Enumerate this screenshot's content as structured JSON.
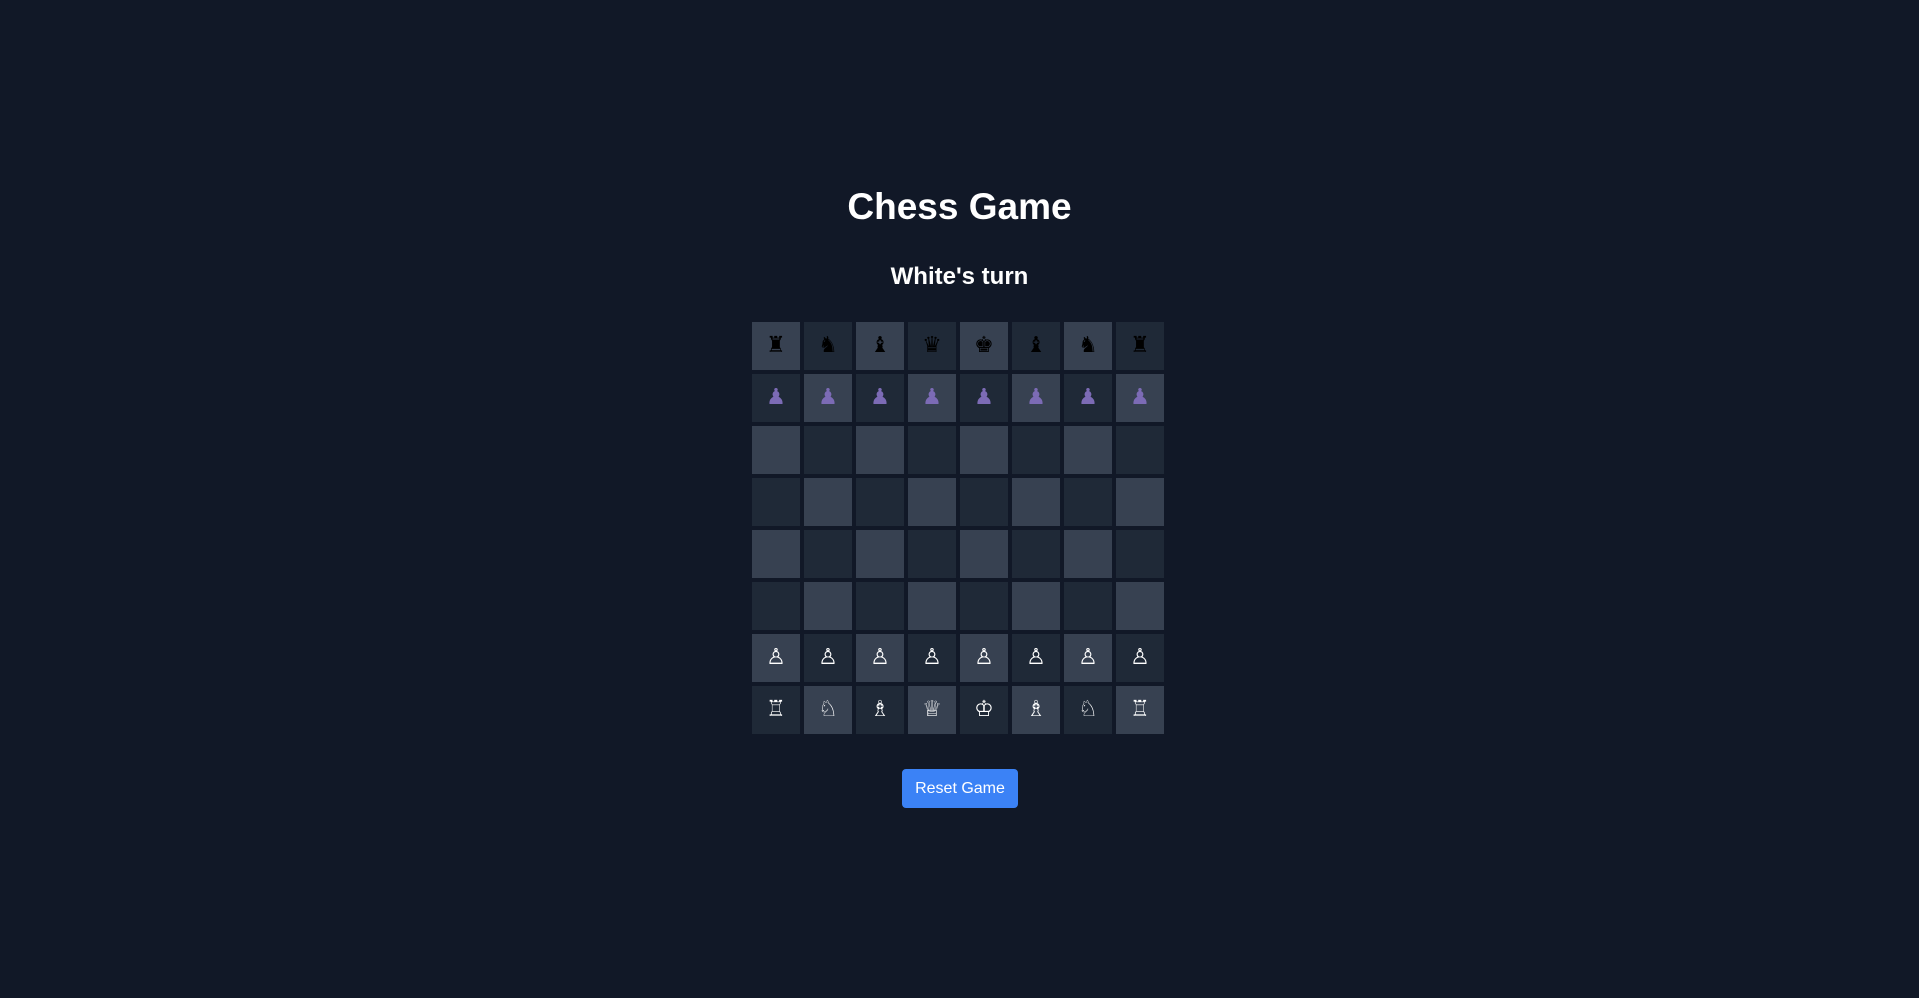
{
  "header": {
    "title": "Chess Game",
    "status": "White's turn"
  },
  "board": {
    "light_color": "#374151",
    "dark_color": "#1f2937",
    "rows": [
      [
        {
          "glyph": "♜",
          "piece": "black-rook",
          "color": "black"
        },
        {
          "glyph": "♞",
          "piece": "black-knight",
          "color": "black"
        },
        {
          "glyph": "♝",
          "piece": "black-bishop",
          "color": "black"
        },
        {
          "glyph": "♛",
          "piece": "black-queen",
          "color": "black"
        },
        {
          "glyph": "♚",
          "piece": "black-king",
          "color": "black"
        },
        {
          "glyph": "♝",
          "piece": "black-bishop",
          "color": "black"
        },
        {
          "glyph": "♞",
          "piece": "black-knight",
          "color": "black"
        },
        {
          "glyph": "♜",
          "piece": "black-rook",
          "color": "black"
        }
      ],
      [
        {
          "glyph": "♟",
          "piece": "black-pawn",
          "color": "purple"
        },
        {
          "glyph": "♟",
          "piece": "black-pawn",
          "color": "purple"
        },
        {
          "glyph": "♟",
          "piece": "black-pawn",
          "color": "purple"
        },
        {
          "glyph": "♟",
          "piece": "black-pawn",
          "color": "purple"
        },
        {
          "glyph": "♟",
          "piece": "black-pawn",
          "color": "purple"
        },
        {
          "glyph": "♟",
          "piece": "black-pawn",
          "color": "purple"
        },
        {
          "glyph": "♟",
          "piece": "black-pawn",
          "color": "purple"
        },
        {
          "glyph": "♟",
          "piece": "black-pawn",
          "color": "purple"
        }
      ],
      [
        null,
        null,
        null,
        null,
        null,
        null,
        null,
        null
      ],
      [
        null,
        null,
        null,
        null,
        null,
        null,
        null,
        null
      ],
      [
        null,
        null,
        null,
        null,
        null,
        null,
        null,
        null
      ],
      [
        null,
        null,
        null,
        null,
        null,
        null,
        null,
        null
      ],
      [
        {
          "glyph": "♙",
          "piece": "white-pawn",
          "color": "white"
        },
        {
          "glyph": "♙",
          "piece": "white-pawn",
          "color": "white"
        },
        {
          "glyph": "♙",
          "piece": "white-pawn",
          "color": "white"
        },
        {
          "glyph": "♙",
          "piece": "white-pawn",
          "color": "white"
        },
        {
          "glyph": "♙",
          "piece": "white-pawn",
          "color": "white"
        },
        {
          "glyph": "♙",
          "piece": "white-pawn",
          "color": "white"
        },
        {
          "glyph": "♙",
          "piece": "white-pawn",
          "color": "white"
        },
        {
          "glyph": "♙",
          "piece": "white-pawn",
          "color": "white"
        }
      ],
      [
        {
          "glyph": "♖",
          "piece": "white-rook",
          "color": "white"
        },
        {
          "glyph": "♘",
          "piece": "white-knight",
          "color": "white"
        },
        {
          "glyph": "♗",
          "piece": "white-bishop",
          "color": "white"
        },
        {
          "glyph": "♕",
          "piece": "white-queen",
          "color": "white"
        },
        {
          "glyph": "♔",
          "piece": "white-king",
          "color": "white"
        },
        {
          "glyph": "♗",
          "piece": "white-bishop",
          "color": "white"
        },
        {
          "glyph": "♘",
          "piece": "white-knight",
          "color": "white"
        },
        {
          "glyph": "♖",
          "piece": "white-rook",
          "color": "white"
        }
      ]
    ]
  },
  "controls": {
    "reset_label": "Reset Game",
    "reset_color": "#3b82f6"
  }
}
